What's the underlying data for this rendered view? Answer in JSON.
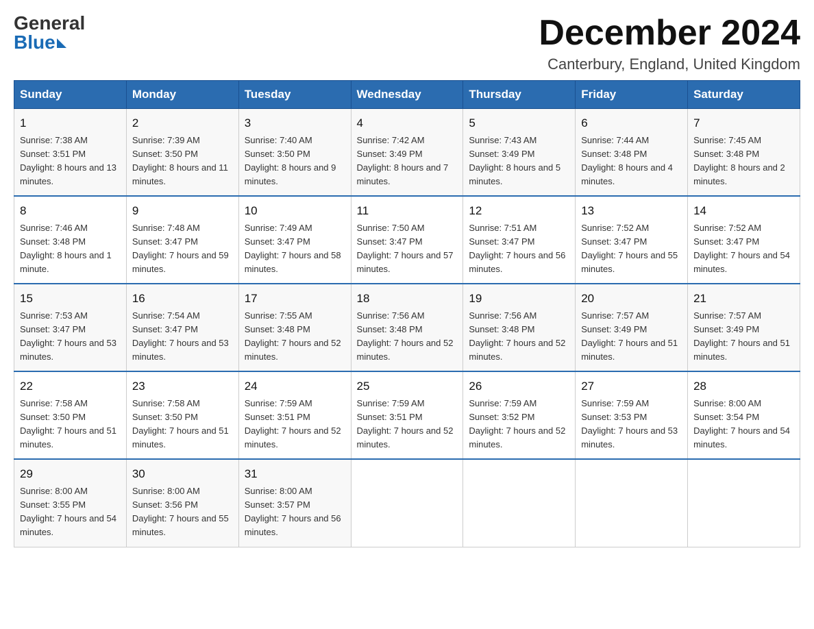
{
  "logo": {
    "general": "General",
    "blue": "Blue"
  },
  "title": "December 2024",
  "subtitle": "Canterbury, England, United Kingdom",
  "days": [
    "Sunday",
    "Monday",
    "Tuesday",
    "Wednesday",
    "Thursday",
    "Friday",
    "Saturday"
  ],
  "weeks": [
    [
      {
        "day": "1",
        "sunrise": "7:38 AM",
        "sunset": "3:51 PM",
        "daylight": "8 hours and 13 minutes."
      },
      {
        "day": "2",
        "sunrise": "7:39 AM",
        "sunset": "3:50 PM",
        "daylight": "8 hours and 11 minutes."
      },
      {
        "day": "3",
        "sunrise": "7:40 AM",
        "sunset": "3:50 PM",
        "daylight": "8 hours and 9 minutes."
      },
      {
        "day": "4",
        "sunrise": "7:42 AM",
        "sunset": "3:49 PM",
        "daylight": "8 hours and 7 minutes."
      },
      {
        "day": "5",
        "sunrise": "7:43 AM",
        "sunset": "3:49 PM",
        "daylight": "8 hours and 5 minutes."
      },
      {
        "day": "6",
        "sunrise": "7:44 AM",
        "sunset": "3:48 PM",
        "daylight": "8 hours and 4 minutes."
      },
      {
        "day": "7",
        "sunrise": "7:45 AM",
        "sunset": "3:48 PM",
        "daylight": "8 hours and 2 minutes."
      }
    ],
    [
      {
        "day": "8",
        "sunrise": "7:46 AM",
        "sunset": "3:48 PM",
        "daylight": "8 hours and 1 minute."
      },
      {
        "day": "9",
        "sunrise": "7:48 AM",
        "sunset": "3:47 PM",
        "daylight": "7 hours and 59 minutes."
      },
      {
        "day": "10",
        "sunrise": "7:49 AM",
        "sunset": "3:47 PM",
        "daylight": "7 hours and 58 minutes."
      },
      {
        "day": "11",
        "sunrise": "7:50 AM",
        "sunset": "3:47 PM",
        "daylight": "7 hours and 57 minutes."
      },
      {
        "day": "12",
        "sunrise": "7:51 AM",
        "sunset": "3:47 PM",
        "daylight": "7 hours and 56 minutes."
      },
      {
        "day": "13",
        "sunrise": "7:52 AM",
        "sunset": "3:47 PM",
        "daylight": "7 hours and 55 minutes."
      },
      {
        "day": "14",
        "sunrise": "7:52 AM",
        "sunset": "3:47 PM",
        "daylight": "7 hours and 54 minutes."
      }
    ],
    [
      {
        "day": "15",
        "sunrise": "7:53 AM",
        "sunset": "3:47 PM",
        "daylight": "7 hours and 53 minutes."
      },
      {
        "day": "16",
        "sunrise": "7:54 AM",
        "sunset": "3:47 PM",
        "daylight": "7 hours and 53 minutes."
      },
      {
        "day": "17",
        "sunrise": "7:55 AM",
        "sunset": "3:48 PM",
        "daylight": "7 hours and 52 minutes."
      },
      {
        "day": "18",
        "sunrise": "7:56 AM",
        "sunset": "3:48 PM",
        "daylight": "7 hours and 52 minutes."
      },
      {
        "day": "19",
        "sunrise": "7:56 AM",
        "sunset": "3:48 PM",
        "daylight": "7 hours and 52 minutes."
      },
      {
        "day": "20",
        "sunrise": "7:57 AM",
        "sunset": "3:49 PM",
        "daylight": "7 hours and 51 minutes."
      },
      {
        "day": "21",
        "sunrise": "7:57 AM",
        "sunset": "3:49 PM",
        "daylight": "7 hours and 51 minutes."
      }
    ],
    [
      {
        "day": "22",
        "sunrise": "7:58 AM",
        "sunset": "3:50 PM",
        "daylight": "7 hours and 51 minutes."
      },
      {
        "day": "23",
        "sunrise": "7:58 AM",
        "sunset": "3:50 PM",
        "daylight": "7 hours and 51 minutes."
      },
      {
        "day": "24",
        "sunrise": "7:59 AM",
        "sunset": "3:51 PM",
        "daylight": "7 hours and 52 minutes."
      },
      {
        "day": "25",
        "sunrise": "7:59 AM",
        "sunset": "3:51 PM",
        "daylight": "7 hours and 52 minutes."
      },
      {
        "day": "26",
        "sunrise": "7:59 AM",
        "sunset": "3:52 PM",
        "daylight": "7 hours and 52 minutes."
      },
      {
        "day": "27",
        "sunrise": "7:59 AM",
        "sunset": "3:53 PM",
        "daylight": "7 hours and 53 minutes."
      },
      {
        "day": "28",
        "sunrise": "8:00 AM",
        "sunset": "3:54 PM",
        "daylight": "7 hours and 54 minutes."
      }
    ],
    [
      {
        "day": "29",
        "sunrise": "8:00 AM",
        "sunset": "3:55 PM",
        "daylight": "7 hours and 54 minutes."
      },
      {
        "day": "30",
        "sunrise": "8:00 AM",
        "sunset": "3:56 PM",
        "daylight": "7 hours and 55 minutes."
      },
      {
        "day": "31",
        "sunrise": "8:00 AM",
        "sunset": "3:57 PM",
        "daylight": "7 hours and 56 minutes."
      },
      null,
      null,
      null,
      null
    ]
  ]
}
